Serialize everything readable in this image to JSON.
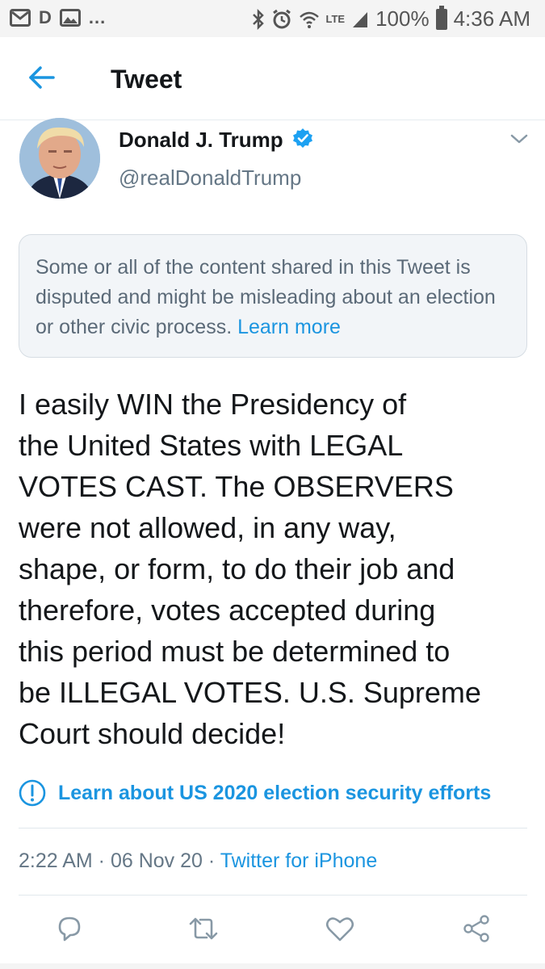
{
  "status_bar": {
    "left_icons": [
      "gmail-icon",
      "d-app-icon",
      "gallery-icon"
    ],
    "more": "...",
    "network": "LTE",
    "battery": "100%",
    "time": "4:36 AM"
  },
  "header": {
    "title": "Tweet"
  },
  "author": {
    "name": "Donald J. Trump",
    "handle": "@realDonaldTrump",
    "verified": true
  },
  "notice": {
    "text": "Some or all of the content shared in this Tweet is disputed and might be misleading about an election or other civic process.",
    "link": "Learn more"
  },
  "tweet": {
    "lines": [
      "I easily WIN the Presidency of",
      "the United States with LEGAL",
      "VOTES CAST. The OBSERVERS",
      "were not allowed, in any way,",
      "shape, or form, to do their job and",
      "therefore, votes accepted during",
      "this period must be determined to",
      "be ILLEGAL VOTES. U.S. Supreme",
      "Court should decide!"
    ]
  },
  "election_link": {
    "label": "Learn about US 2020 election security efforts"
  },
  "meta": {
    "time": "2:22 AM",
    "separator": " · ",
    "date": "06 Nov 20",
    "source": "Twitter for iPhone"
  },
  "actions": [
    "reply-icon",
    "retweet-icon",
    "like-icon",
    "share-icon"
  ],
  "colors": {
    "accent": "#1b95e0",
    "verified": "#1da1f2",
    "secondary_text": "#657786",
    "notice_bg": "#f2f5f8"
  }
}
